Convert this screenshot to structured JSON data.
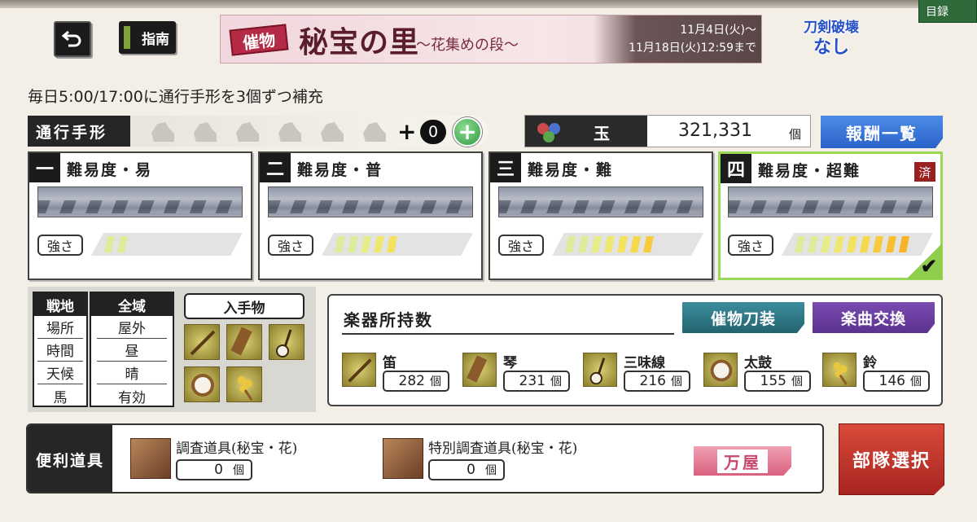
{
  "corner_tab": "目録",
  "header": {
    "guide_label": "指南",
    "event_tag": "催物",
    "event_title": "秘宝の里",
    "event_subtitle": "〜花集めの段〜",
    "event_date_start": "11月4日(火)〜",
    "event_date_end": "11月18日(火)12:59まで",
    "no_break_line1": "刀剣破壊",
    "no_break_line2": "なし"
  },
  "refill_notice": "毎日5:00/17:00に通行手形を3個ずつ補充",
  "pass": {
    "label": "通行手形",
    "plus": "+",
    "count": "0"
  },
  "gems": {
    "label": "玉",
    "value": "321,331",
    "unit": "個"
  },
  "reward_button": "報酬一覧",
  "difficulties": [
    {
      "num": "一",
      "title": "難易度・易",
      "strength_label": "強さ",
      "level": 2,
      "done": ""
    },
    {
      "num": "二",
      "title": "難易度・普",
      "strength_label": "強さ",
      "level": 5,
      "done": ""
    },
    {
      "num": "三",
      "title": "難易度・難",
      "strength_label": "強さ",
      "level": 7,
      "done": ""
    },
    {
      "num": "四",
      "title": "難易度・超難",
      "strength_label": "強さ",
      "level": 9,
      "done": "済"
    }
  ],
  "conditions": {
    "labels": [
      "戦地",
      "場所",
      "時間",
      "天候",
      "馬"
    ],
    "values": [
      "全域",
      "屋外",
      "昼",
      "晴",
      "有効"
    ],
    "get_label": "入手物"
  },
  "instruments": {
    "title": "楽器所持数",
    "armor_button": "催物刀装",
    "music_button": "楽曲交換",
    "unit": "個",
    "items": [
      {
        "name": "笛",
        "count": "282"
      },
      {
        "name": "琴",
        "count": "231"
      },
      {
        "name": "三味線",
        "count": "216"
      },
      {
        "name": "太鼓",
        "count": "155"
      },
      {
        "name": "鈴",
        "count": "146"
      }
    ]
  },
  "tools": {
    "label": "便利道具",
    "unit": "個",
    "items": [
      {
        "name": "調査道具(秘宝・花)",
        "count": "0"
      },
      {
        "name": "特別調査道具(秘宝・花)",
        "count": "0"
      }
    ],
    "shop_button": "万屋"
  },
  "unit_select_button": "部隊選択",
  "colors": {
    "accent_blue": "#2a62c8",
    "selected_border": "#9ad85a",
    "done_badge": "#9a1f1f",
    "unit_button": "#a82420"
  }
}
